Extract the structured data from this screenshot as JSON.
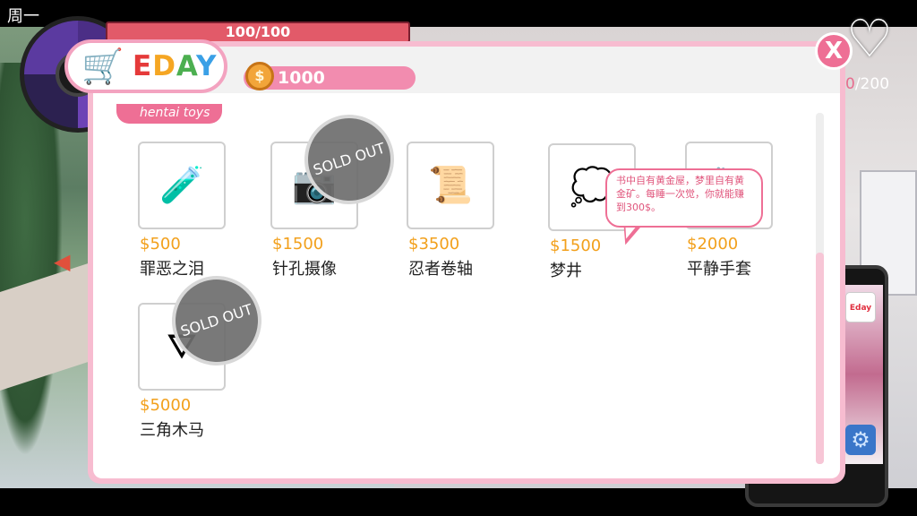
{
  "hud": {
    "day_label": "周一",
    "hp_text": "100/100",
    "heart_counter_current": "0",
    "heart_counter_total": "/200"
  },
  "shop": {
    "logo_letters": [
      "E",
      "D",
      "A",
      "Y"
    ],
    "cart_glyph": "🛒",
    "money": "1000",
    "close_label": "X",
    "category_label": "hentai toys"
  },
  "items": [
    {
      "price": "$500",
      "name": "罪恶之泪",
      "icon": "🧪",
      "sold_out": false
    },
    {
      "price": "$1500",
      "name": "针孔摄像",
      "icon": "📷",
      "sold_out": true
    },
    {
      "price": "$3500",
      "name": "忍者卷轴",
      "icon": "📜",
      "sold_out": false
    },
    {
      "price": "$1500",
      "name": "梦井",
      "icon": "💭",
      "sold_out": false
    },
    {
      "price": "$2000",
      "name": "平静手套",
      "icon": "🧤",
      "sold_out": false
    },
    {
      "price": "$5000",
      "name": "三角木马",
      "icon": "⛛",
      "sold_out": true
    }
  ],
  "sold_out_label": "SOLD OUT",
  "tooltip": {
    "text": "书中自有黄金屋，梦里自有黄金矿。每睡一次觉，你就能赚到300$。"
  },
  "phone": {
    "app_label": "Eday"
  },
  "colors": {
    "accent": "#ee6f95",
    "price": "#f2a01c",
    "modal_border": "#f7bcd0"
  }
}
